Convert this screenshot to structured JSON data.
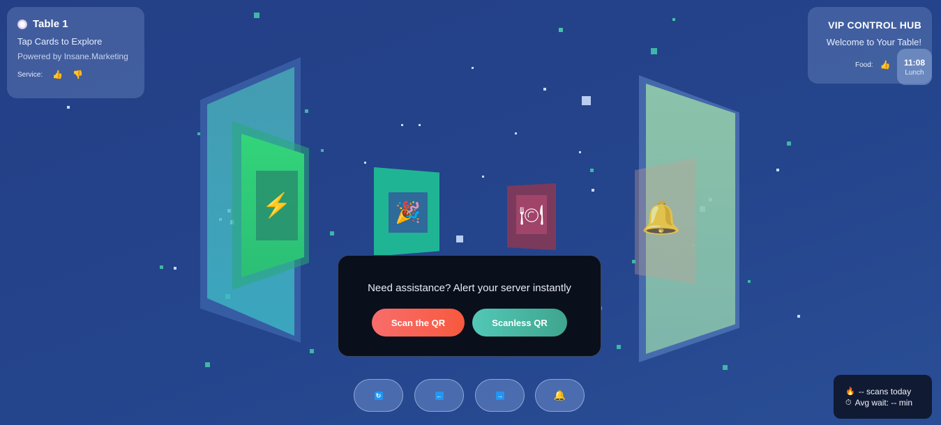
{
  "table": {
    "title": "Table 1",
    "subtitle": "Tap Cards to Explore",
    "powered_by": "Powered by Insane.Marketing",
    "service_label": "Service:",
    "thumb_up_icon": "thumbs-up",
    "thumb_down_icon": "thumbs-down"
  },
  "hub": {
    "title": "VIP CONTROL HUB",
    "welcome": "Welcome to Your Table!",
    "food_label": "Food:",
    "time": "11:08",
    "meal": "Lunch"
  },
  "assist": {
    "prompt": "Need assistance? Alert your server instantly",
    "scan_label": "Scan the QR",
    "scanless_label": "Scanless QR"
  },
  "nav": {
    "refresh_icon": "refresh-icon",
    "prev_icon": "arrow-left-icon",
    "next_icon": "arrow-right-icon",
    "bell_icon": "bell-icon"
  },
  "stats": {
    "scans": "-- scans today",
    "wait": "Avg wait: -- min"
  },
  "colors": {
    "background": "#243f86",
    "scan_button": "#f7593e",
    "scanless_button": "#3fa58e",
    "modal": "#0a0f1c"
  }
}
